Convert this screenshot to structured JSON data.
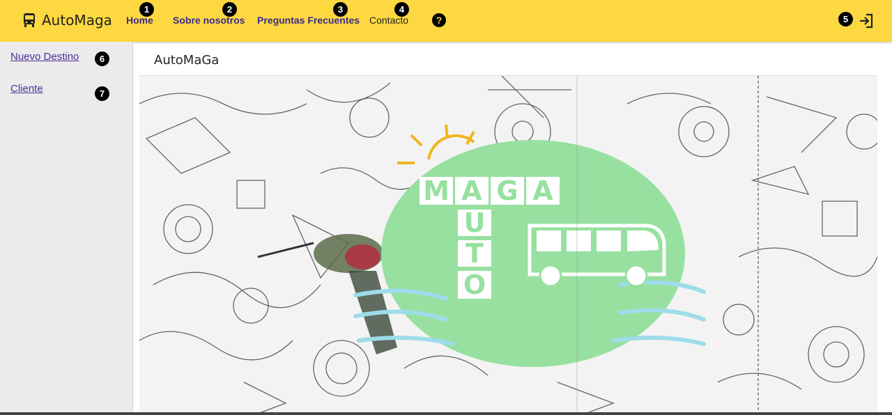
{
  "app": {
    "title": "AutoMaga"
  },
  "nav": {
    "items": [
      {
        "label": "Home",
        "badge": "1"
      },
      {
        "label": "Sobre nosotros",
        "badge": "2"
      },
      {
        "label": "Preguntas Frecuentes",
        "badge": "3"
      },
      {
        "label": "Contacto",
        "badge": "4"
      }
    ],
    "help_icon": "question-circle-icon",
    "login_icon": "login-icon",
    "login_badge": "5"
  },
  "sidebar": {
    "items": [
      {
        "label": "Nuevo Destino",
        "badge": "6"
      },
      {
        "label": "Cliente",
        "badge": "7"
      }
    ]
  },
  "main": {
    "title": "AutoMaGa",
    "banner": {
      "logo_letters_top": [
        "M",
        "A",
        "G",
        "A"
      ],
      "logo_letters_vertical": [
        "U",
        "T",
        "O"
      ],
      "icon": "bus-icon"
    }
  },
  "colors": {
    "toolbar": "#fdd840",
    "link": "#3a2a8c",
    "sidebar": "#ebebeb",
    "logo_circle": "#97e0a0",
    "waves": "#9ddcea"
  }
}
